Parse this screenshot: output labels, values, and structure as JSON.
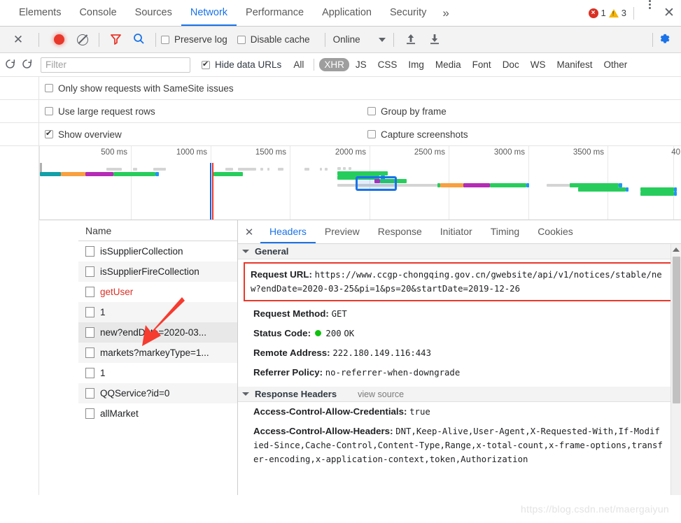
{
  "window": {
    "main_tabs": [
      {
        "label": "Elements",
        "active": false
      },
      {
        "label": "Console",
        "active": false
      },
      {
        "label": "Sources",
        "active": false
      },
      {
        "label": "Network",
        "active": true
      },
      {
        "label": "Performance",
        "active": false
      },
      {
        "label": "Application",
        "active": false
      },
      {
        "label": "Security",
        "active": false
      }
    ],
    "more_tabs_label": "»",
    "error_count": "1",
    "warning_count": "3",
    "error_icon": "error-circle-icon",
    "warning_icon": "warning-triangle-icon",
    "menu_icon": "kebab-menu-icon",
    "close_icon": "close-icon"
  },
  "toolbar": {
    "close_label": "✕",
    "record_icon": "record-button-icon",
    "clear_icon": "clear-icon",
    "filter_icon": "funnel-filter-icon",
    "search_icon": "search-icon",
    "preserve_log": {
      "label": "Preserve log",
      "checked": false
    },
    "disable_cache": {
      "label": "Disable cache",
      "checked": false
    },
    "throttle_value": "Online",
    "import_har_icon": "upload-arrow-icon",
    "export_har_icon": "download-arrow-icon",
    "settings_icon": "gear-icon"
  },
  "filterbar": {
    "reload_icon": "reload-icon",
    "hard_reload_icon": "hard-reload-icon",
    "filter_value": "",
    "filter_placeholder": "Filter",
    "hide_data_urls": {
      "label": "Hide data URLs",
      "checked": true
    },
    "types": [
      {
        "label": "All",
        "selected": false
      },
      {
        "label": "XHR",
        "selected": true
      },
      {
        "label": "JS",
        "selected": false
      },
      {
        "label": "CSS",
        "selected": false
      },
      {
        "label": "Img",
        "selected": false
      },
      {
        "label": "Media",
        "selected": false
      },
      {
        "label": "Font",
        "selected": false
      },
      {
        "label": "Doc",
        "selected": false
      },
      {
        "label": "WS",
        "selected": false
      },
      {
        "label": "Manifest",
        "selected": false
      },
      {
        "label": "Other",
        "selected": false
      }
    ]
  },
  "options": {
    "samesite": {
      "label": "Only show requests with SameSite issues",
      "checked": false
    },
    "large_rows": {
      "label": "Use large request rows",
      "checked": false
    },
    "group_by_frame": {
      "label": "Group by frame",
      "checked": false
    },
    "show_overview": {
      "label": "Show overview",
      "checked": true
    },
    "capture_screenshots": {
      "label": "Capture screenshots",
      "checked": false
    }
  },
  "overview": {
    "ticks": [
      "500 ms",
      "1000 ms",
      "1500 ms",
      "2000 ms",
      "2500 ms",
      "3000 ms",
      "3500 ms",
      "40"
    ],
    "domcontentloaded_color": "#1a5fd6",
    "load_color": "#e8382b",
    "selection_color": "#1a73e8"
  },
  "requests": {
    "column_header": "Name",
    "rows": [
      {
        "name": "isSupplierCollection",
        "error": false,
        "selected": false
      },
      {
        "name": "isSupplierFireCollection",
        "error": false,
        "selected": false
      },
      {
        "name": "getUser",
        "error": true,
        "selected": false
      },
      {
        "name": "1",
        "error": false,
        "selected": false
      },
      {
        "name": "new?endDate=2020-03...",
        "error": false,
        "selected": true
      },
      {
        "name": "markets?markeyType=1...",
        "error": false,
        "selected": false
      },
      {
        "name": "1",
        "error": false,
        "selected": false
      },
      {
        "name": "QQService?id=0",
        "error": false,
        "selected": false
      },
      {
        "name": "allMarket",
        "error": false,
        "selected": false
      }
    ]
  },
  "details": {
    "close_label": "✕",
    "tabs": [
      {
        "label": "Headers",
        "active": true
      },
      {
        "label": "Preview",
        "active": false
      },
      {
        "label": "Response",
        "active": false
      },
      {
        "label": "Initiator",
        "active": false
      },
      {
        "label": "Timing",
        "active": false
      },
      {
        "label": "Cookies",
        "active": false
      }
    ],
    "general": {
      "section_title": "General",
      "request_url_key": "Request URL:",
      "request_url_value": "https://www.ccgp-chongqing.gov.cn/gwebsite/api/v1/notices/stable/new?endDate=2020-03-25&pi=1&ps=20&startDate=2019-12-26",
      "request_method_key": "Request Method:",
      "request_method_value": "GET",
      "status_code_key": "Status Code:",
      "status_code_value": "200",
      "status_code_text": "OK",
      "status_icon": "green-status-dot-icon",
      "remote_address_key": "Remote Address:",
      "remote_address_value": "222.180.149.116:443",
      "referrer_policy_key": "Referrer Policy:",
      "referrer_policy_value": "no-referrer-when-downgrade"
    },
    "response_headers": {
      "section_title": "Response Headers",
      "view_source_label": "view source",
      "items": [
        {
          "key": "Access-Control-Allow-Credentials:",
          "value": "true"
        },
        {
          "key": "Access-Control-Allow-Headers:",
          "value": "DNT,Keep-Alive,User-Agent,X-Requested-With,If-Modified-Since,Cache-Control,Content-Type,Range,x-total-count,x-frame-options,transfer-encoding,x-application-context,token,Authorization"
        }
      ]
    }
  },
  "annotation": {
    "arrow_icon": "red-annotation-arrow-icon",
    "arrow_color": "#f63b2f",
    "highlight_box_color": "#e8382b"
  },
  "watermark": "https://blog.csdn.net/maergaiyun"
}
